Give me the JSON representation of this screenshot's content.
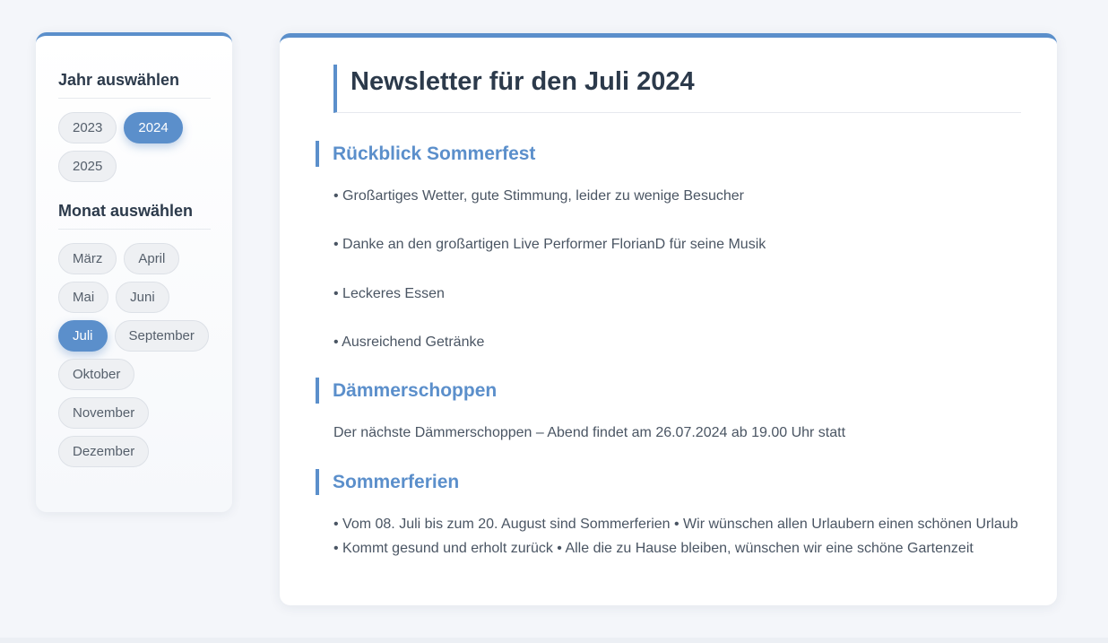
{
  "sidebar": {
    "year_heading": "Jahr auswählen",
    "years": [
      {
        "label": "2023",
        "active": false
      },
      {
        "label": "2024",
        "active": true
      },
      {
        "label": "2025",
        "active": false
      }
    ],
    "month_heading": "Monat auswählen",
    "months": [
      {
        "label": "März",
        "active": false
      },
      {
        "label": "April",
        "active": false
      },
      {
        "label": "Mai",
        "active": false
      },
      {
        "label": "Juni",
        "active": false
      },
      {
        "label": "Juli",
        "active": true
      },
      {
        "label": "September",
        "active": false
      },
      {
        "label": "Oktober",
        "active": false
      },
      {
        "label": "November",
        "active": false
      },
      {
        "label": "Dezember",
        "active": false
      }
    ]
  },
  "newsletter": {
    "title": "Newsletter für den Juli 2024",
    "sections": [
      {
        "title": "Rückblick Sommerfest",
        "lines": [
          "• Großartiges Wetter, gute Stimmung, leider zu wenige Besucher",
          "• Danke an den großartigen Live Performer FlorianD für seine Musik",
          "• Leckeres Essen",
          "• Ausreichend Getränke"
        ]
      },
      {
        "title": "Dämmerschoppen",
        "lines": [
          "Der nächste Dämmerschoppen – Abend findet am 26.07.2024 ab 19.00 Uhr statt"
        ]
      },
      {
        "title": "Sommerferien",
        "lines": [
          "• Vom 08. Juli bis zum 20. August sind Sommerferien • Wir wünschen allen Urlaubern einen schönen Urlaub",
          "• Kommt gesund und erholt zurück • Alle die zu Hause bleiben, wünschen wir eine schöne Gartenzeit"
        ]
      }
    ]
  },
  "colors": {
    "accent": "#5b8fcb",
    "background": "#f4f6fa",
    "text": "#2c3a4b"
  }
}
